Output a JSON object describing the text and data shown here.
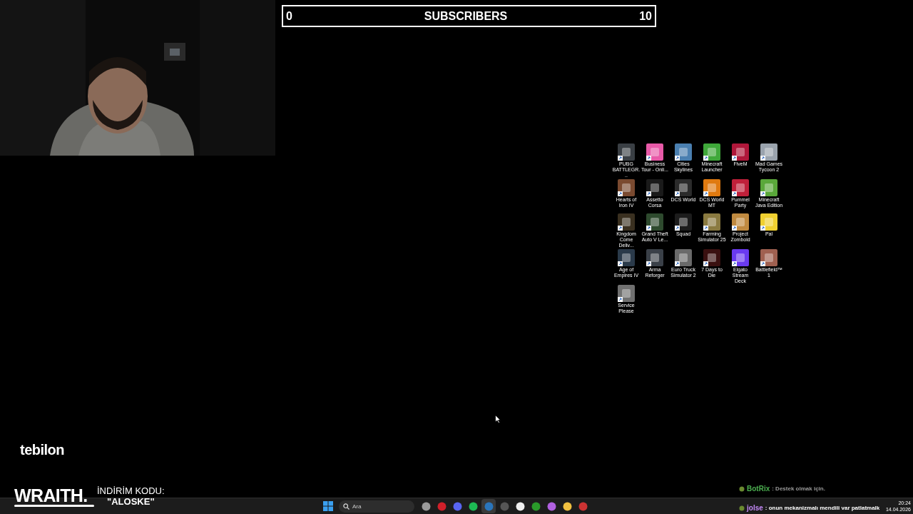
{
  "subscriber_goal": {
    "current": "0",
    "label": "SUBSCRIBERS",
    "target": "10",
    "level": 0
  },
  "desktop_icons": [
    {
      "label": "PUBG BATTLEGR..."
    },
    {
      "label": "Business Tour - Onli..."
    },
    {
      "label": "Cities Skylines"
    },
    {
      "label": "Minecraft Launcher"
    },
    {
      "label": "FiveM"
    },
    {
      "label": "Mad Games Tycoon 2"
    },
    {
      "label": "Hearts of Iron IV"
    },
    {
      "label": "Assetto Corsa"
    },
    {
      "label": "DCS World"
    },
    {
      "label": "DCS World MT"
    },
    {
      "label": "Pummel Party"
    },
    {
      "label": "Minecraft Java Edition"
    },
    {
      "label": "Kingdom Come Deliv..."
    },
    {
      "label": "Grand Theft Auto V Le..."
    },
    {
      "label": "Squad"
    },
    {
      "label": "Farming Simulator 25"
    },
    {
      "label": "Project Zomboid"
    },
    {
      "label": "Pal"
    },
    {
      "label": "Age of Empires IV"
    },
    {
      "label": "Arma Reforger"
    },
    {
      "label": "Euro Truck Simulator 2"
    },
    {
      "label": "7 Days to Die"
    },
    {
      "label": "Elgato Stream Deck"
    },
    {
      "label": "Battlefield™ 1"
    },
    {
      "label": "Service Please"
    }
  ],
  "sponsor": {
    "brand": "tebilon"
  },
  "promo": {
    "brand": "WRAITH.",
    "line1": "İNDİRİM KODU:",
    "line2": "\"ALOSKE\""
  },
  "chat": [
    {
      "user": "BotRix",
      "message": ": Destek olmak için.",
      "color": "#4caf50",
      "faded": true
    },
    {
      "user": "jolse",
      "message": ": onun mekanizmalı mendili var patlatmalk",
      "color": "#c58af9",
      "faded": false
    }
  ],
  "taskbar": {
    "search": {
      "placeholder": "Ara"
    },
    "clock": {
      "time": "20:24",
      "date": "14.04.2026"
    }
  }
}
